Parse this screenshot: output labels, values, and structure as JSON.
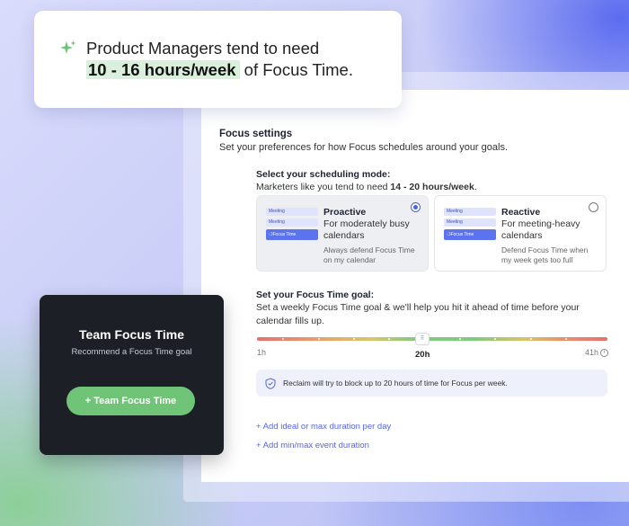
{
  "callout": {
    "line1": "Product Managers tend to need",
    "highlight": "10 - 16 hours/week",
    "line2_rest": " of Focus Time.",
    "sparkle_color": "#6fc477"
  },
  "focus_settings": {
    "title": "Focus settings",
    "subtitle": "Set your preferences for how Focus schedules around your goals."
  },
  "scheduling_mode": {
    "title": "Select your scheduling mode:",
    "subtitle_prefix": "Marketers like you tend to need ",
    "subtitle_value": "14 - 20 hours/week",
    "subtitle_suffix": ".",
    "mini_calendar": {
      "meeting_label": "Meeting",
      "focus_label": "Focus Time"
    },
    "options": [
      {
        "title": "Proactive",
        "description": "For moderately busy calendars",
        "note": "Always defend Focus Time on my calendar",
        "selected": true
      },
      {
        "title": "Reactive",
        "description": "For meeting-heavy calendars",
        "note": "Defend Focus Time when my week gets too full",
        "selected": false
      }
    ]
  },
  "goal": {
    "title": "Set your Focus Time goal:",
    "subtitle": "Set a weekly Focus Time goal & we'll help you hit it ahead of time before your calendar fills up.",
    "slider": {
      "min_label": "1h",
      "value_label": "20h",
      "max_label": "41h",
      "value": 20,
      "min": 1,
      "max": 41,
      "handle_glyph": "⠿"
    },
    "reclaim_note": "Reclaim will try to block up to 20 hours of time for Focus per week."
  },
  "links": {
    "add_duration": "+ Add ideal or max duration per day",
    "add_event_duration": "+ Add min/max event duration"
  },
  "team": {
    "title": "Team Focus Time",
    "subtitle": "Recommend a Focus Time goal",
    "button": "+ Team Focus Time"
  },
  "colors": {
    "accent": "#4d62e8",
    "green": "#6fc477",
    "dark_card": "#1c1f26",
    "link": "#5566e4"
  }
}
